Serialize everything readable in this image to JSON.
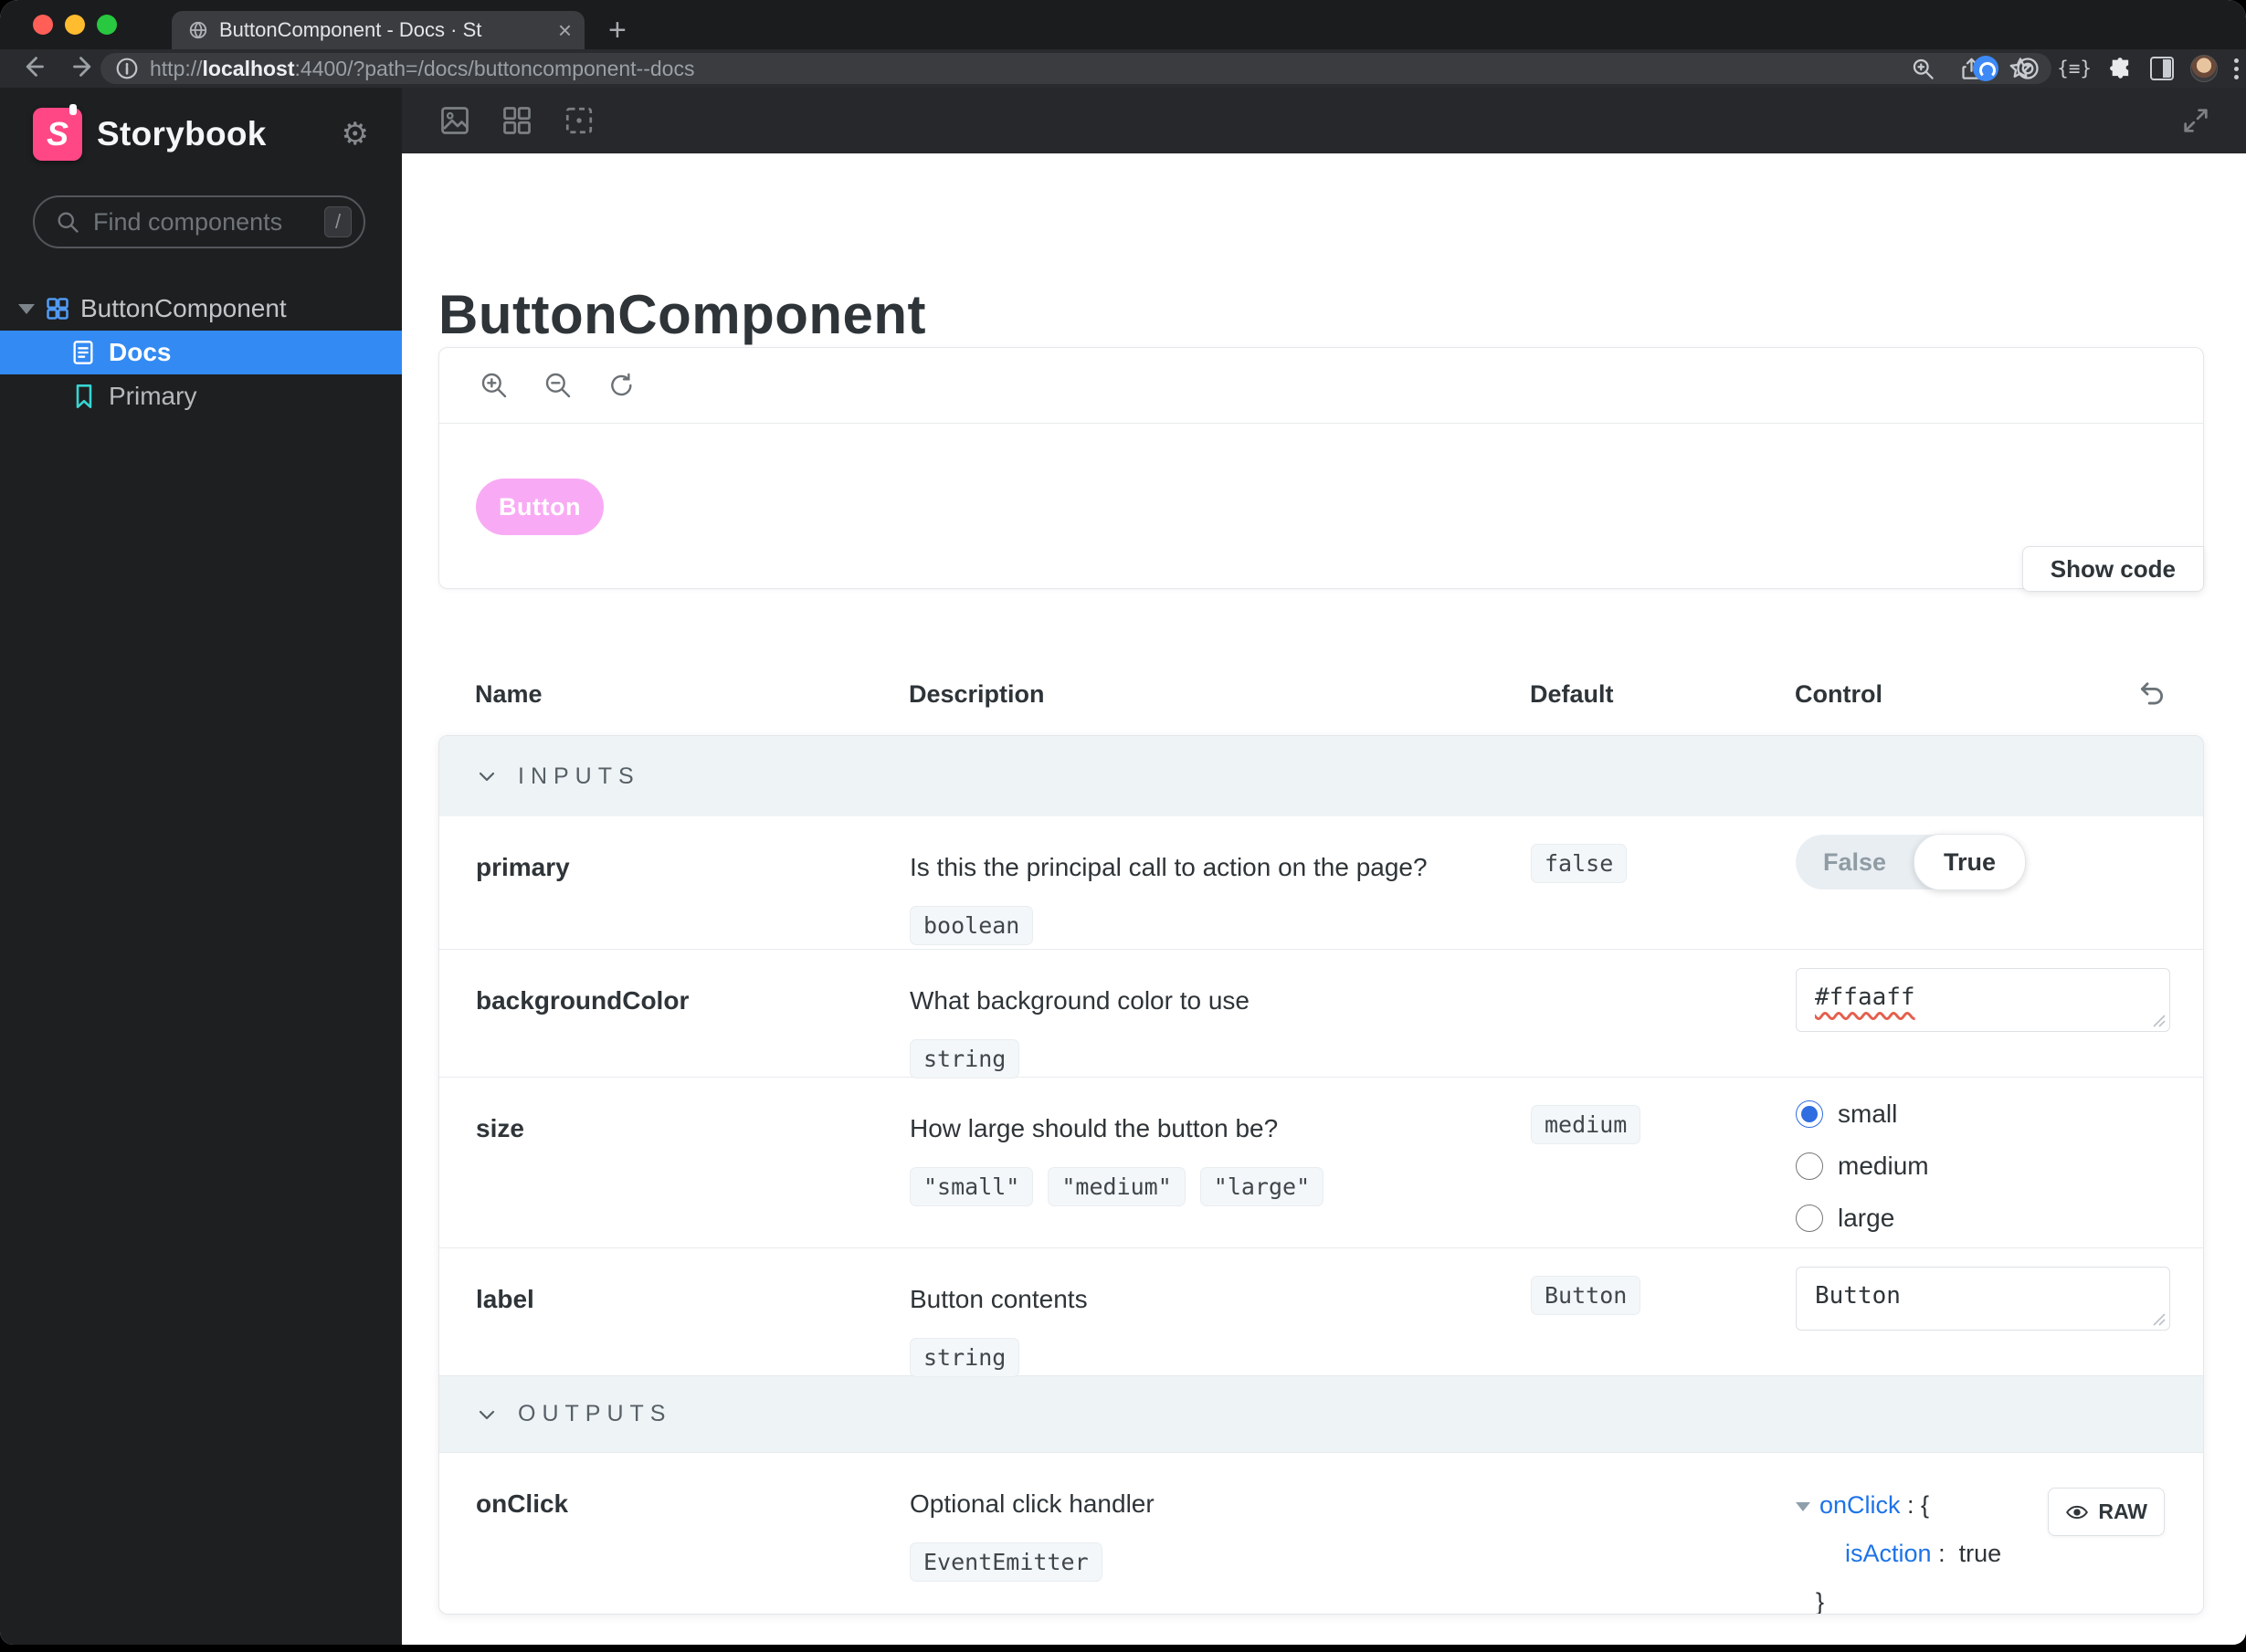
{
  "browser": {
    "tab_title": "ButtonComponent - Docs · St",
    "close": "×",
    "new_tab": "+",
    "url_scheme": "http://",
    "url_host": "localhost",
    "url_rest": ":4400/?path=/docs/buttoncomponent--docs"
  },
  "sidebar": {
    "brand": "Storybook",
    "brand_initial": "S",
    "search_placeholder": "Find components",
    "search_shortcut": "/",
    "component": "ButtonComponent",
    "docs": "Docs",
    "story": "Primary"
  },
  "page": {
    "title": "ButtonComponent",
    "show_code": "Show code",
    "preview_button": "Button"
  },
  "args": {
    "headers": {
      "name": "Name",
      "description": "Description",
      "default": "Default",
      "control": "Control"
    },
    "sections": {
      "inputs": "INPUTS",
      "outputs": "OUTPUTS"
    },
    "rows": [
      {
        "name": "primary",
        "description": "Is this the principal call to action on the page?",
        "type": "boolean",
        "default": "false",
        "control": {
          "off": "False",
          "on": "True",
          "value": true
        }
      },
      {
        "name": "backgroundColor",
        "description": "What background color to use",
        "type": "string",
        "default": "",
        "control": {
          "value": "#ffaaff"
        }
      },
      {
        "name": "size",
        "description": "How large should the button be?",
        "type_options": [
          "\"small\"",
          "\"medium\"",
          "\"large\""
        ],
        "default": "medium",
        "control": {
          "options": [
            "small",
            "medium",
            "large"
          ],
          "selected": "small"
        }
      },
      {
        "name": "label",
        "description": "Button contents",
        "type": "string",
        "default": "Button",
        "control": {
          "value": "Button"
        }
      },
      {
        "name": "onClick",
        "description": "Optional click handler",
        "type": "EventEmitter",
        "control": {
          "key": "onClick",
          "open": ": {",
          "child_key": "isAction",
          "child_sep": ":",
          "child_value": "true",
          "close": "}",
          "raw": "RAW"
        }
      }
    ]
  },
  "colors": {
    "accent_blue": "#338af3",
    "link_blue": "#1d73e8",
    "brand_pink": "#ff4785",
    "story_teal": "#37d5d3",
    "button_pink": "#f8abf4"
  }
}
